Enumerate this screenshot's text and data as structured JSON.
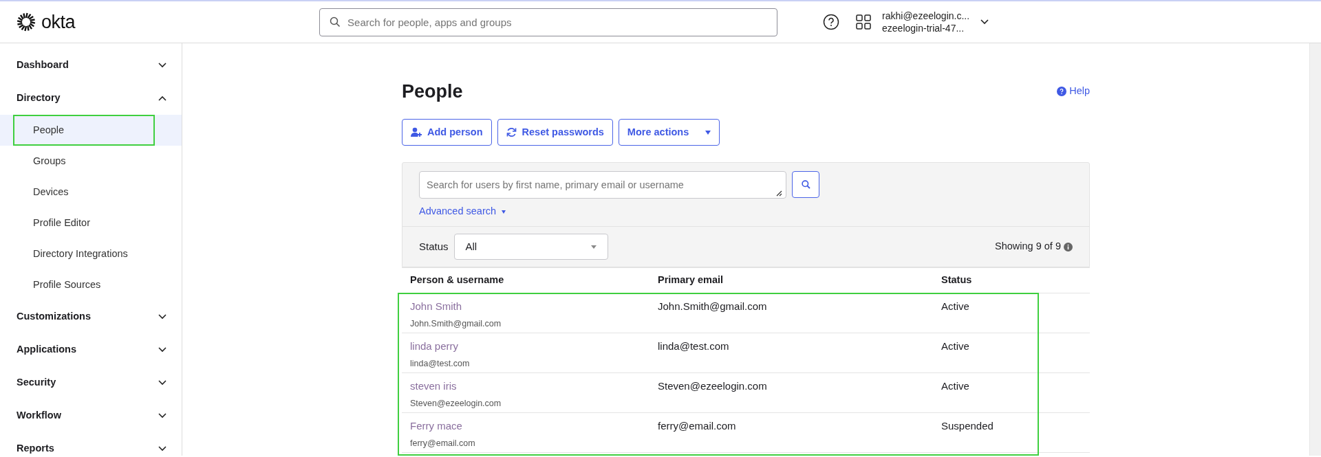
{
  "header": {
    "logo_text": "okta",
    "search": {
      "placeholder": "Search for people, apps and groups"
    },
    "user": {
      "email": "rakhi@ezeelogin.c...",
      "org": "ezeelogin-trial-47..."
    }
  },
  "sidebar": {
    "sections": [
      {
        "label": "Dashboard",
        "expanded": false
      },
      {
        "label": "Directory",
        "expanded": true,
        "children": [
          {
            "label": "People",
            "selected": true,
            "highlighted": true
          },
          {
            "label": "Groups",
            "selected": false,
            "highlighted": false
          },
          {
            "label": "Devices",
            "selected": false,
            "highlighted": false
          },
          {
            "label": "Profile Editor",
            "selected": false,
            "highlighted": false
          },
          {
            "label": "Directory Integrations",
            "selected": false,
            "highlighted": false
          },
          {
            "label": "Profile Sources",
            "selected": false,
            "highlighted": false
          }
        ]
      },
      {
        "label": "Customizations",
        "expanded": false
      },
      {
        "label": "Applications",
        "expanded": false
      },
      {
        "label": "Security",
        "expanded": false
      },
      {
        "label": "Workflow",
        "expanded": false
      },
      {
        "label": "Reports",
        "expanded": false
      }
    ]
  },
  "page": {
    "title": "People",
    "help": "Help",
    "buttons": [
      {
        "label": "Add person",
        "kind": "add"
      },
      {
        "label": "Reset passwords",
        "kind": "reset"
      },
      {
        "label": "More actions",
        "kind": "menu"
      }
    ],
    "search": {
      "placeholder": "Search for users by first name, primary email or username"
    },
    "advanced_search": "Advanced search",
    "filter": {
      "label": "Status",
      "value": "All"
    },
    "count": "Showing 9 of 9",
    "table": {
      "columns": [
        "Person & username",
        "Primary email",
        "Status"
      ],
      "highlighted": true,
      "rows": [
        {
          "name": "John Smith",
          "username": "John.Smith@gmail.com",
          "email": "John.Smith@gmail.com",
          "status": "Active"
        },
        {
          "name": "linda perry",
          "username": "linda@test.com",
          "email": "linda@test.com",
          "status": "Active"
        },
        {
          "name": "steven iris",
          "username": "Steven@ezeelogin.com",
          "email": "Steven@ezeelogin.com",
          "status": "Active"
        },
        {
          "name": "Ferry mace",
          "username": "ferry@email.com",
          "email": "ferry@email.com",
          "status": "Suspended"
        }
      ]
    }
  }
}
